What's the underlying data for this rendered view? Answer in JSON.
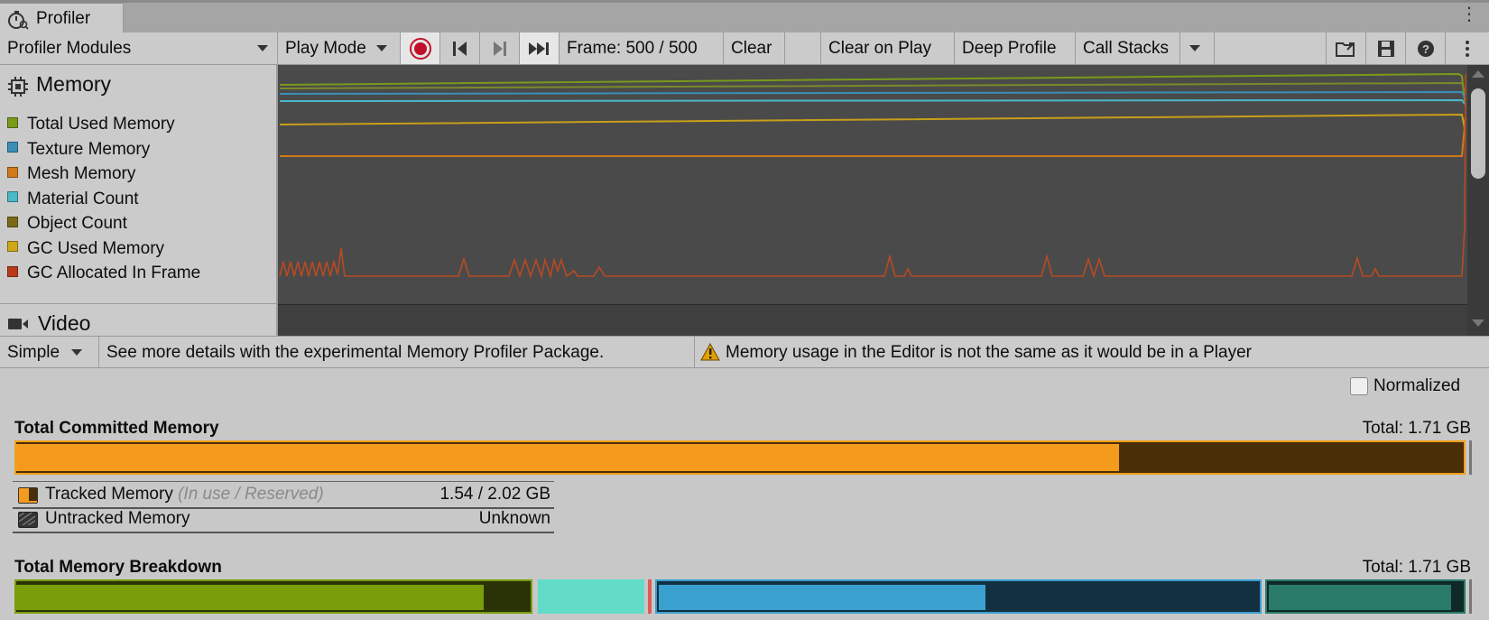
{
  "window": {
    "tab_label": "Profiler",
    "menu_glyph": "⋮"
  },
  "toolbar": {
    "modules_label": "Profiler Modules",
    "play_mode_label": "Play Mode",
    "frame_label": "Frame: 500 / 500",
    "clear_label": "Clear",
    "clear_on_play_label": "Clear on Play",
    "deep_profile_label": "Deep Profile",
    "call_stacks_label": "Call Stacks",
    "icons": [
      "record-icon",
      "prev-frame-icon",
      "next-frame-icon",
      "current-frame-icon",
      "load-icon",
      "save-icon",
      "help-icon",
      "more-icon"
    ]
  },
  "modules": {
    "memory_title": "Memory",
    "legend": [
      {
        "label": "Total Used Memory",
        "color": "#7a9a1a"
      },
      {
        "label": "Texture Memory",
        "color": "#3a8fb8"
      },
      {
        "label": "Mesh Memory",
        "color": "#d07a1a"
      },
      {
        "label": "Material Count",
        "color": "#4ab8c8"
      },
      {
        "label": "Object Count",
        "color": "#7a6a18"
      },
      {
        "label": "GC Used Memory",
        "color": "#d0a818"
      },
      {
        "label": "GC Allocated In Frame",
        "color": "#b83a1a"
      }
    ],
    "video_title": "Video"
  },
  "details": {
    "view_mode": "Simple",
    "link_text": "See more details with the experimental Memory Profiler Package.",
    "warning_text": "Memory usage in the Editor is not the same as it would be in a Player",
    "normalized_label": "Normalized",
    "normalized_checked": false
  },
  "committed": {
    "title": "Total Committed Memory",
    "total": "Total: 1.71 GB",
    "in_use_fraction": 0.762,
    "tracked_label": "Tracked Memory",
    "tracked_sub": "(In use / Reserved)",
    "tracked_value": "1.54 / 2.02 GB",
    "untracked_label": "Untracked Memory",
    "untracked_value": "Unknown"
  },
  "breakdown": {
    "title": "Total Memory Breakdown",
    "total": "Total: 1.71 GB",
    "colors": {
      "green": "#7a9e0a",
      "green_dark": "#2a3306",
      "aqua": "#62dcc8",
      "red": "#e05a5a",
      "blue": "#3aa0d0",
      "blue_dark": "#123040",
      "teal": "#2a7a6a",
      "teal_dark": "#0f2a26"
    }
  }
}
